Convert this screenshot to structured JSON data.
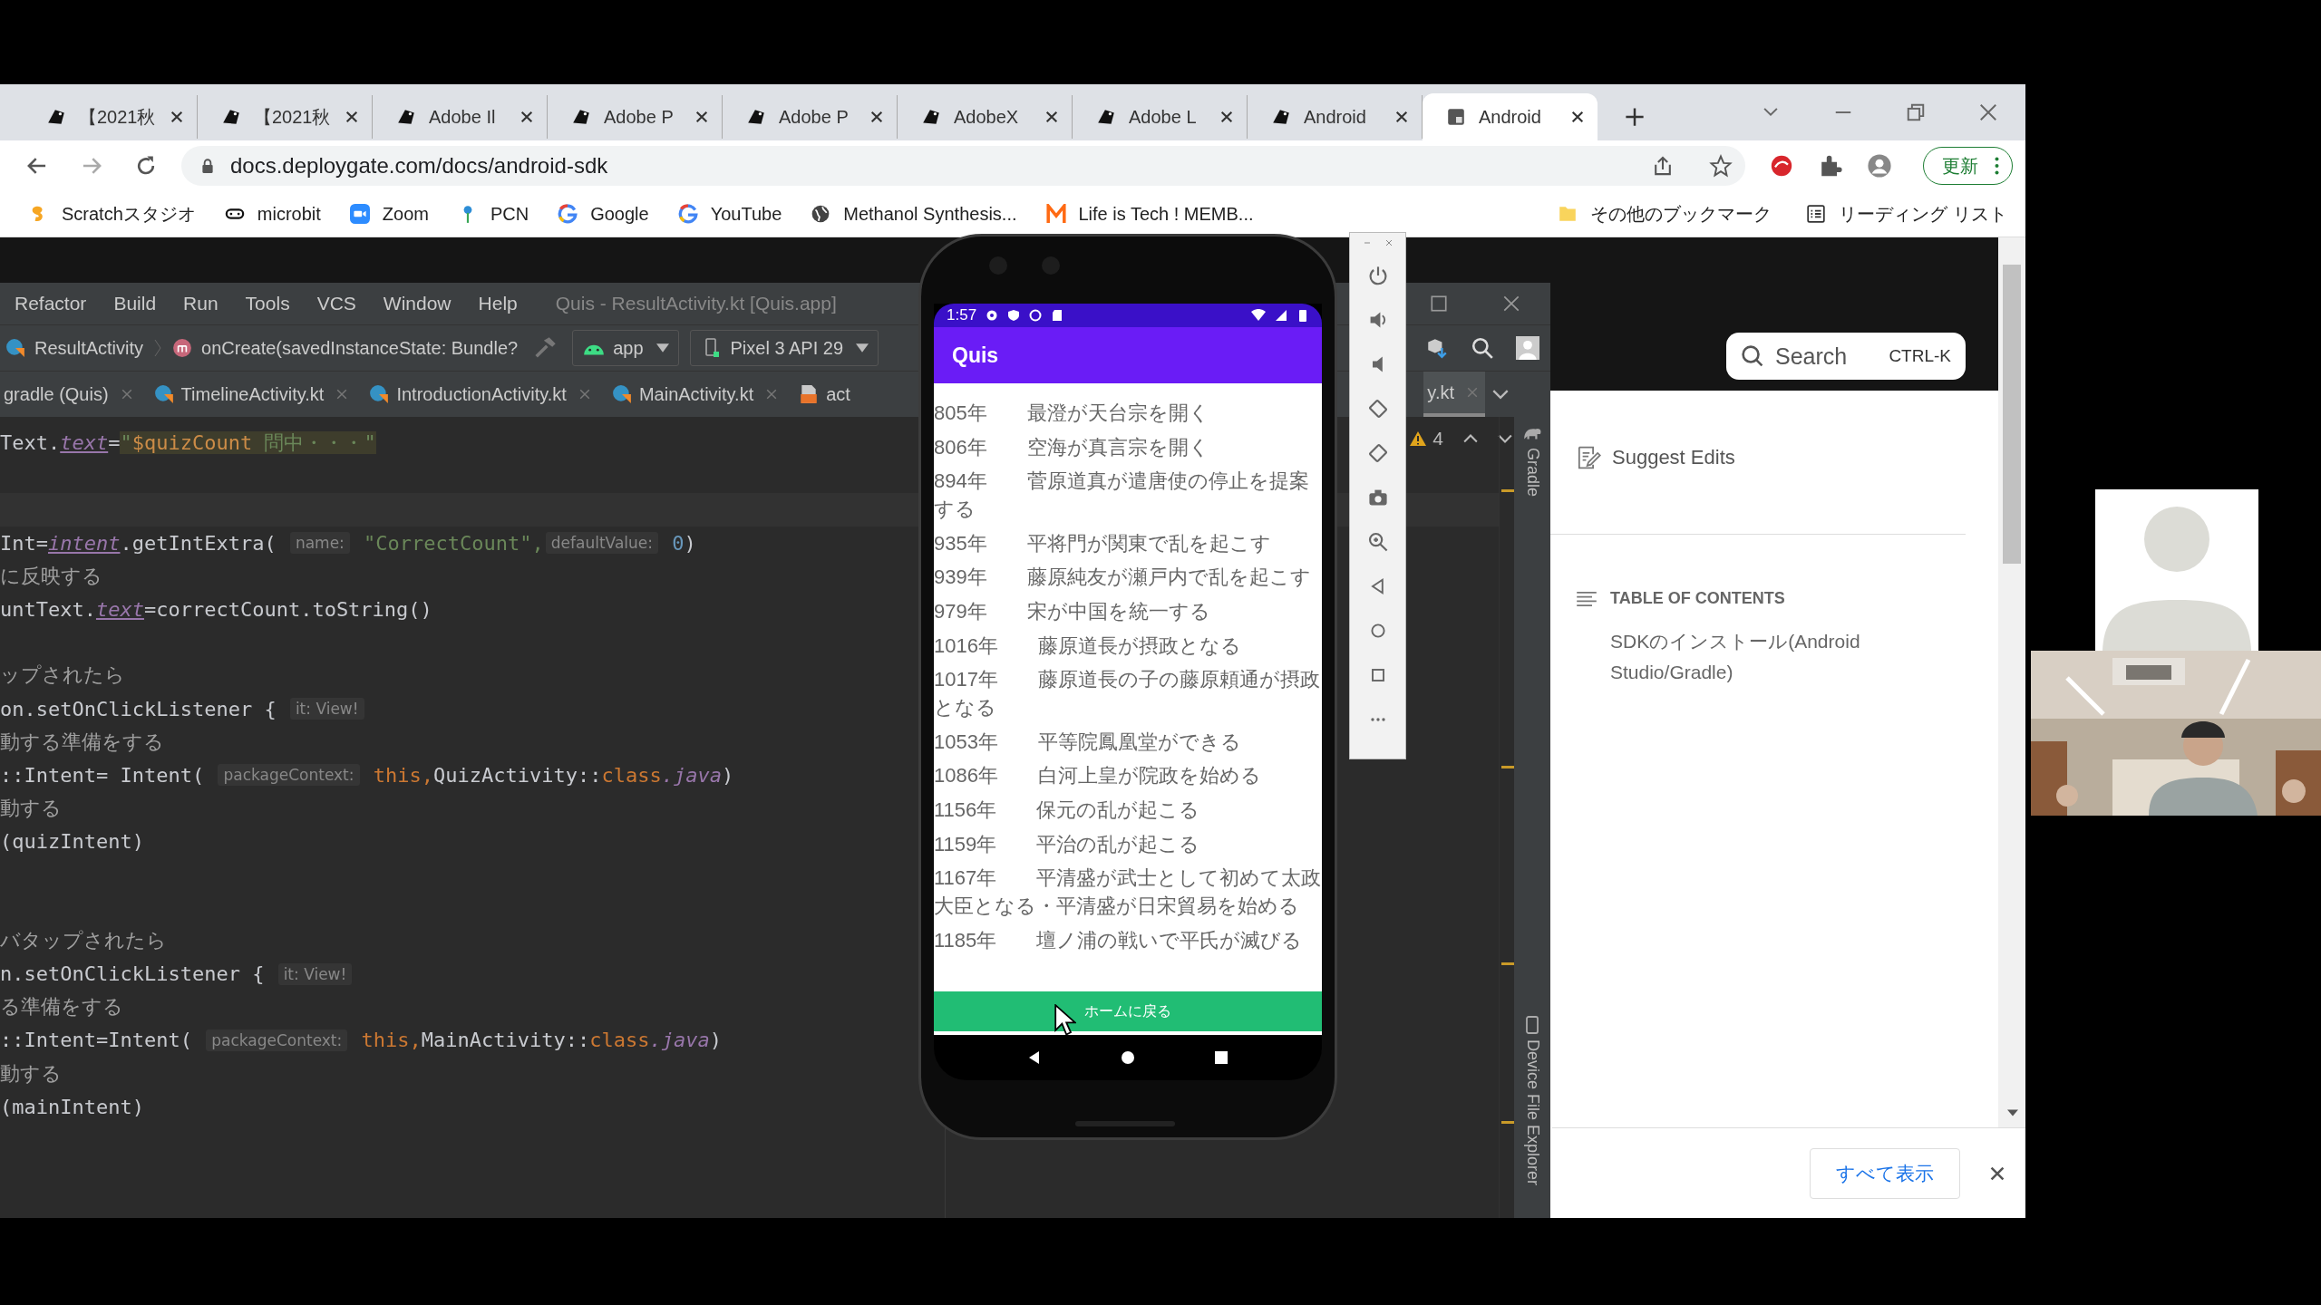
{
  "browser": {
    "tabs": [
      {
        "title": "【2021秋",
        "kind": "site",
        "selected": false
      },
      {
        "title": "【2021秋",
        "kind": "site",
        "selected": false
      },
      {
        "title": "Adobe Il",
        "kind": "site",
        "selected": false
      },
      {
        "title": "Adobe P",
        "kind": "site",
        "selected": false
      },
      {
        "title": "Adobe P",
        "kind": "site",
        "selected": false
      },
      {
        "title": "AdobeX",
        "kind": "site",
        "selected": false
      },
      {
        "title": "Adobe L",
        "kind": "site",
        "selected": false
      },
      {
        "title": "Android",
        "kind": "site",
        "selected": false
      },
      {
        "title": "Android",
        "kind": "doc",
        "selected": true
      }
    ],
    "address": "docs.deploygate.com/docs/android-sdk",
    "update_button": "更新",
    "bookmarks": [
      {
        "label": "Scratchスタジオ",
        "kind": "scratch"
      },
      {
        "label": "microbit",
        "kind": "link"
      },
      {
        "label": "Zoom",
        "kind": "zoom"
      },
      {
        "label": "PCN",
        "kind": "pin"
      },
      {
        "label": "Google",
        "kind": "google"
      },
      {
        "label": "YouTube",
        "kind": "google"
      },
      {
        "label": "Methanol Synthesis...",
        "kind": "globe"
      },
      {
        "label": "Life is Tech ! MEMB...",
        "kind": "m"
      }
    ],
    "bookmarks_right": [
      {
        "label": "その他のブックマーク",
        "kind": "folder"
      },
      {
        "label": "リーディング リスト",
        "kind": "list"
      }
    ]
  },
  "webpage": {
    "search": {
      "placeholder": "Search",
      "shortcut": "CTRL-K"
    },
    "suggest_edits": "Suggest Edits",
    "toc_heading": "TABLE OF CONTENTS",
    "toc_items": [
      "SDKのインストール(Android Studio/Gradle)"
    ],
    "banner_button": "すべて表示"
  },
  "ide": {
    "menu": [
      "Refactor",
      "Build",
      "Run",
      "Tools",
      "VCS",
      "Window",
      "Help"
    ],
    "title": "Quis - ResultActivity.kt [Quis.app]",
    "breadcrumb": [
      "ResultActivity",
      "onCreate(savedInstanceState: Bundle?"
    ],
    "run_config": "app",
    "device": "Pixel 3 API 29",
    "editor_tabs": [
      {
        "label": "gradle (Quis)",
        "kind": "gradle",
        "selected": false
      },
      {
        "label": "TimelineActivity.kt",
        "kind": "kotlin",
        "selected": false
      },
      {
        "label": "IntroductionActivity.kt",
        "kind": "kotlin",
        "selected": false
      },
      {
        "label": "MainActivity.kt",
        "kind": "kotlin",
        "selected": false
      },
      {
        "label": "act",
        "kind": "layout",
        "selected": false
      },
      {
        "label": "y.kt",
        "kind": "none",
        "selected": true
      }
    ],
    "warnings": "4",
    "side_panels": [
      "Gradle",
      "Device File Explorer"
    ],
    "code_lines": [
      {
        "kind": "text",
        "segments": [
          {
            "kind": "code",
            "text": "Text."
          },
          {
            "kind": "field",
            "text": "text"
          },
          {
            "kind": "code",
            "text": "="
          },
          {
            "kind": "sel_string",
            "text": "\""
          },
          {
            "kind": "sel_var",
            "text": "$quizCount"
          },
          {
            "kind": "sel_string",
            "text": " 問中・・・\""
          }
        ]
      },
      {
        "kind": "blank"
      },
      {
        "kind": "caret"
      },
      {
        "kind": "text",
        "segments": [
          {
            "kind": "code",
            "text": "Int="
          },
          {
            "kind": "field",
            "text": "intent"
          },
          {
            "kind": "code",
            "text": ".getIntExtra( "
          },
          {
            "kind": "hint",
            "text": "name:"
          },
          {
            "kind": "string",
            "text": " \"CorrectCount\","
          },
          {
            "kind": "hint",
            "text": "defaultValue:"
          },
          {
            "kind": "number",
            "text": " 0"
          },
          {
            "kind": "code",
            "text": ")"
          }
        ]
      },
      {
        "kind": "text",
        "segments": [
          {
            "kind": "comment",
            "text": "に反映する"
          }
        ]
      },
      {
        "kind": "text",
        "segments": [
          {
            "kind": "code",
            "text": "untText."
          },
          {
            "kind": "field",
            "text": "text"
          },
          {
            "kind": "code",
            "text": "=correctCount.toString()"
          }
        ]
      },
      {
        "kind": "blank"
      },
      {
        "kind": "text",
        "segments": [
          {
            "kind": "comment",
            "text": "ップされたら"
          }
        ]
      },
      {
        "kind": "text",
        "segments": [
          {
            "kind": "code",
            "text": "on.setOnClickListener { "
          },
          {
            "kind": "hint",
            "text": "it: View!"
          }
        ]
      },
      {
        "kind": "text",
        "segments": [
          {
            "kind": "comment",
            "text": "動する準備をする"
          }
        ]
      },
      {
        "kind": "text",
        "segments": [
          {
            "kind": "code",
            "text": "::Intent= Intent( "
          },
          {
            "kind": "hint",
            "text": "packageContext:"
          },
          {
            "kind": "keyword",
            "text": " this,"
          },
          {
            "kind": "code",
            "text": "QuizActivity::"
          },
          {
            "kind": "keyword",
            "text": "class"
          },
          {
            "kind": "java",
            "text": ".java"
          },
          {
            "kind": "code",
            "text": ")"
          }
        ]
      },
      {
        "kind": "text",
        "segments": [
          {
            "kind": "comment",
            "text": "動する"
          }
        ]
      },
      {
        "kind": "text",
        "segments": [
          {
            "kind": "code",
            "text": "(quizIntent)"
          }
        ]
      },
      {
        "kind": "blank"
      },
      {
        "kind": "blank"
      },
      {
        "kind": "text",
        "segments": [
          {
            "kind": "comment",
            "text": "バタップされたら"
          }
        ]
      },
      {
        "kind": "text",
        "segments": [
          {
            "kind": "code",
            "text": "n.setOnClickListener { "
          },
          {
            "kind": "hint",
            "text": "it: View!"
          }
        ]
      },
      {
        "kind": "text",
        "segments": [
          {
            "kind": "comment",
            "text": "る準備をする"
          }
        ]
      },
      {
        "kind": "text",
        "segments": [
          {
            "kind": "code",
            "text": "::Intent=Intent( "
          },
          {
            "kind": "hint",
            "text": "packageContext:"
          },
          {
            "kind": "keyword",
            "text": " this,"
          },
          {
            "kind": "code",
            "text": "MainActivity::"
          },
          {
            "kind": "keyword",
            "text": "class"
          },
          {
            "kind": "java",
            "text": ".java"
          },
          {
            "kind": "code",
            "text": ")"
          }
        ]
      },
      {
        "kind": "text",
        "segments": [
          {
            "kind": "comment",
            "text": "動する"
          }
        ]
      },
      {
        "kind": "text",
        "segments": [
          {
            "kind": "code",
            "text": "(mainIntent)"
          }
        ]
      }
    ]
  },
  "emulator": {
    "status_time": "1:57",
    "app_title": "Quis",
    "rows": [
      "805年　　最澄が天台宗を開く",
      "806年　　空海が真言宗を開く",
      "894年　　菅原道真が遣唐使の停止を提案する",
      "935年　　平将門が関東で乱を起こす",
      "939年　　藤原純友が瀬戸内で乱を起こす",
      "979年　　宋が中国を統一する",
      "1016年　　藤原道長が摂政となる",
      "1017年　　藤原道長の子の藤原頼通が摂政となる",
      "1053年　　平等院鳳凰堂ができる",
      "1086年　　白河上皇が院政を始める",
      "1156年　　保元の乱が起こる",
      "1159年　　平治の乱が起こる",
      "1167年　　平清盛が武士として初めて太政大臣となる・平清盛が日宋貿易を始める",
      "1185年　　壇ノ浦の戦いで平氏が滅びる"
    ],
    "home_button": "ホームに戻る"
  },
  "meeting": {
    "tiles": [
      {
        "kind": "avatar"
      },
      {
        "kind": "picture"
      }
    ]
  }
}
